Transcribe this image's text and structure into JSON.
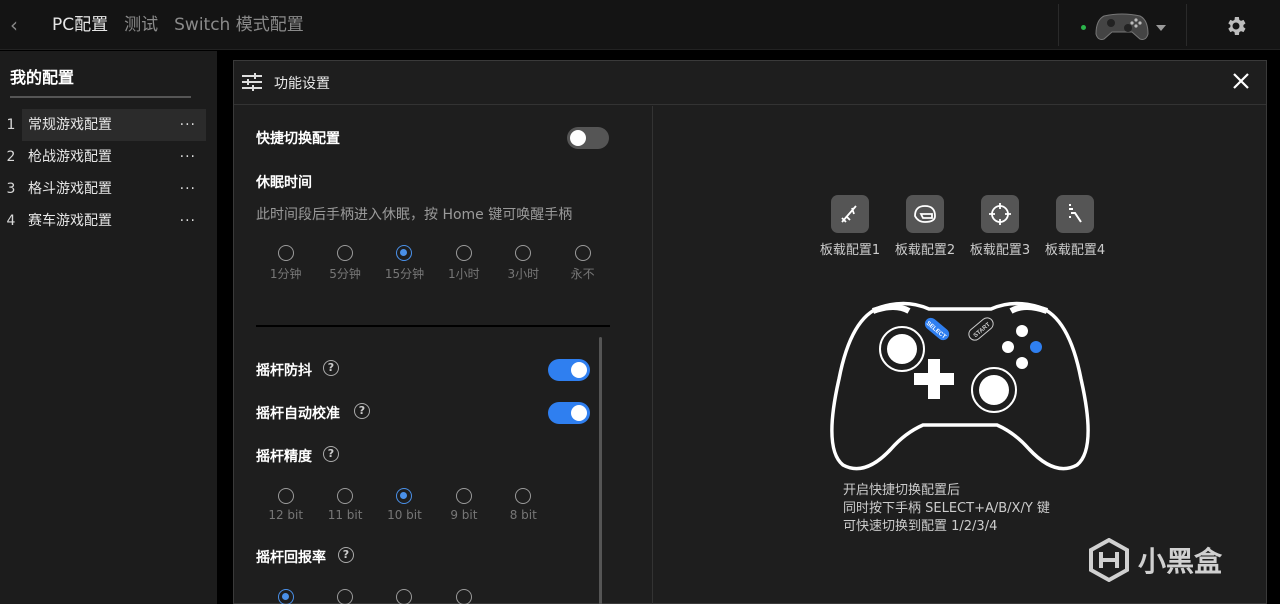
{
  "topbar": {
    "tabs": [
      {
        "label": "PC配置",
        "active": true
      },
      {
        "label": "测试",
        "active": false
      },
      {
        "label": "Switch 模式配置",
        "active": false
      }
    ]
  },
  "sidebar": {
    "title": "我的配置",
    "items": [
      {
        "index": "1",
        "label": "常规游戏配置",
        "active": true
      },
      {
        "index": "2",
        "label": "枪战游戏配置",
        "active": false
      },
      {
        "index": "3",
        "label": "格斗游戏配置",
        "active": false
      },
      {
        "index": "4",
        "label": "赛车游戏配置",
        "active": false
      }
    ],
    "more": "···"
  },
  "dialog": {
    "title": "功能设置",
    "quick_switch": {
      "label": "快捷切换配置",
      "on": false
    },
    "sleep": {
      "label": "休眠时间",
      "desc": "此时间段后手柄进入休眠，按 Home 键可唤醒手柄",
      "options": [
        "1分钟",
        "5分钟",
        "15分钟",
        "1小时",
        "3小时",
        "永不"
      ],
      "selected": 2
    },
    "stick_antishake": {
      "label": "摇杆防抖",
      "on": true
    },
    "stick_autocal": {
      "label": "摇杆自动校准",
      "on": true
    },
    "stick_precision": {
      "label": "摇杆精度",
      "options": [
        "12 bit",
        "11 bit",
        "10 bit",
        "9 bit",
        "8 bit"
      ],
      "selected": 2
    },
    "stick_report": {
      "label": "摇杆回报率",
      "options": [
        "",
        "",
        "",
        ""
      ],
      "selected": 0
    },
    "help": "?",
    "boards": [
      {
        "label": "板载配置1",
        "icon": "sword-icon"
      },
      {
        "label": "板载配置2",
        "icon": "helmet-icon"
      },
      {
        "label": "板载配置3",
        "icon": "crosshair-icon"
      },
      {
        "label": "板载配置4",
        "icon": "racing-icon"
      }
    ],
    "controller": {
      "select": "SELECT",
      "start": "START"
    },
    "hint": [
      "开启快捷切换配置后",
      "同时按下手柄 SELECT+A/B/X/Y 键",
      "可快速切换到配置 1/2/3/4"
    ]
  },
  "watermark": "小黑盒",
  "colors": {
    "accent": "#2f7ff0",
    "panel": "#1e1e1e",
    "sidebar": "#1c1c1c",
    "online": "#2bb54b"
  }
}
